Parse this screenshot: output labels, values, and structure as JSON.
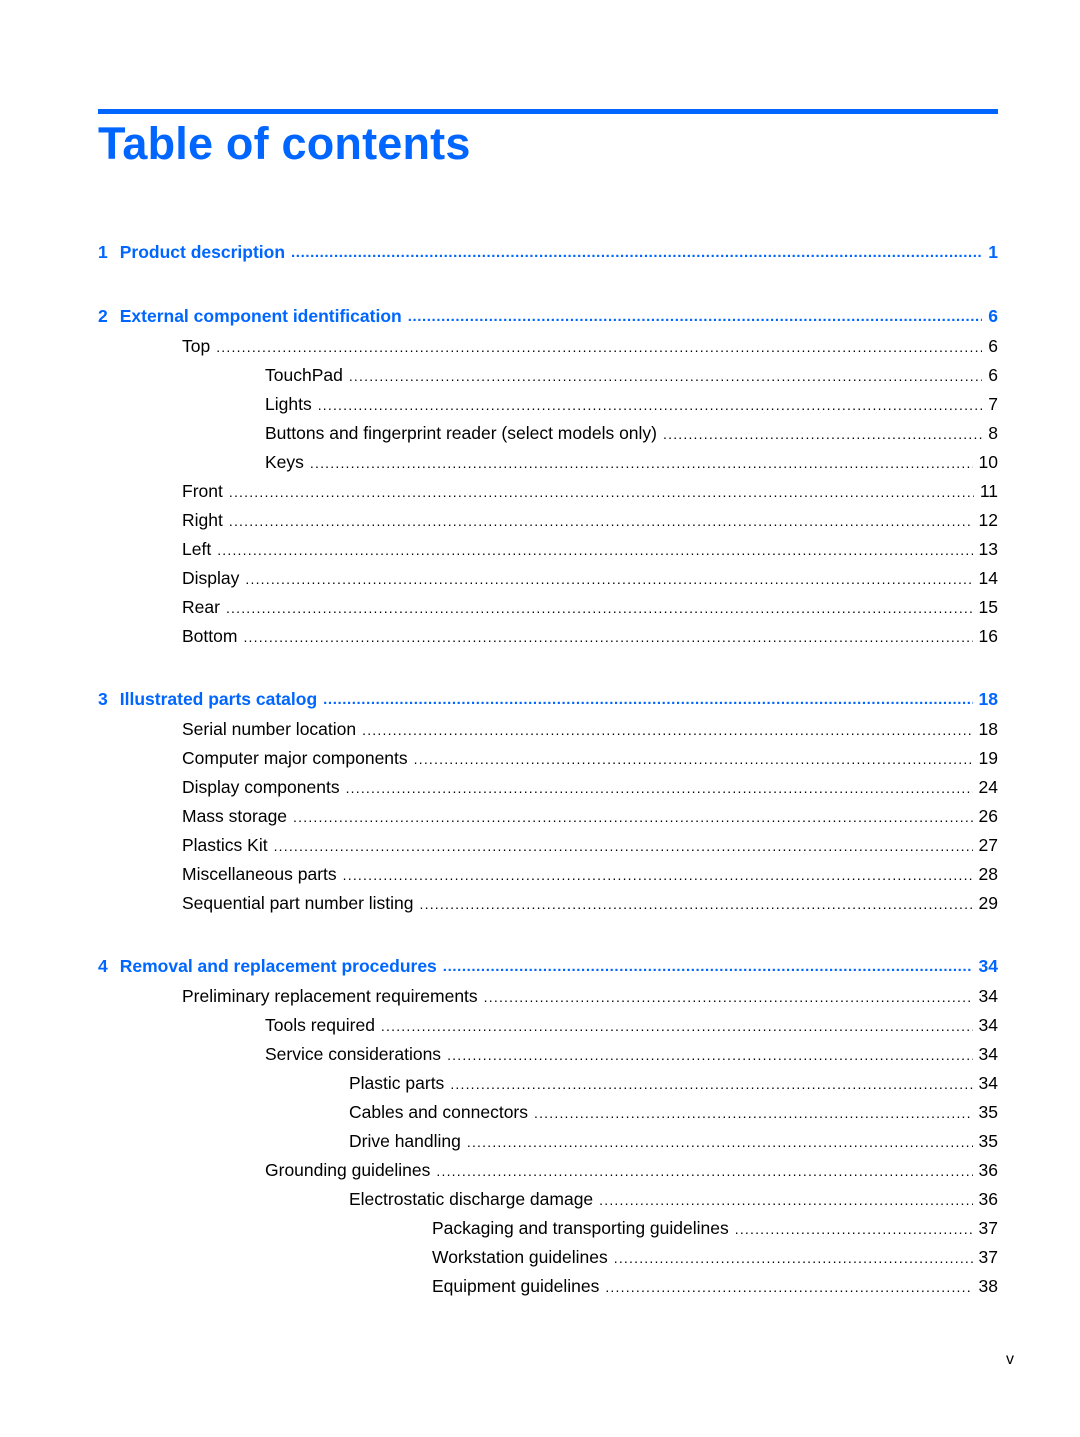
{
  "title": "Table of contents",
  "accent_color": "#0066ff",
  "footer_page": "v",
  "chapters": [
    {
      "number": "1",
      "title": "Product description",
      "page": "1",
      "entries": []
    },
    {
      "number": "2",
      "title": "External component identification",
      "page": "6",
      "entries": [
        {
          "level": 1,
          "title": "Top",
          "page": "6"
        },
        {
          "level": 2,
          "title": "TouchPad",
          "page": "6"
        },
        {
          "level": 2,
          "title": "Lights",
          "page": "7"
        },
        {
          "level": 2,
          "title": "Buttons and fingerprint reader (select models only)",
          "page": "8"
        },
        {
          "level": 2,
          "title": "Keys",
          "page": "10"
        },
        {
          "level": 1,
          "title": "Front",
          "page": "11"
        },
        {
          "level": 1,
          "title": "Right",
          "page": "12"
        },
        {
          "level": 1,
          "title": "Left",
          "page": "13"
        },
        {
          "level": 1,
          "title": "Display",
          "page": "14"
        },
        {
          "level": 1,
          "title": "Rear",
          "page": "15"
        },
        {
          "level": 1,
          "title": "Bottom",
          "page": "16"
        }
      ]
    },
    {
      "number": "3",
      "title": "Illustrated parts catalog",
      "page": "18",
      "entries": [
        {
          "level": 1,
          "title": "Serial number location",
          "page": "18"
        },
        {
          "level": 1,
          "title": "Computer major components",
          "page": "19"
        },
        {
          "level": 1,
          "title": "Display components",
          "page": "24"
        },
        {
          "level": 1,
          "title": "Mass storage",
          "page": "26"
        },
        {
          "level": 1,
          "title": "Plastics Kit",
          "page": "27"
        },
        {
          "level": 1,
          "title": "Miscellaneous parts",
          "page": "28"
        },
        {
          "level": 1,
          "title": "Sequential part number listing",
          "page": "29"
        }
      ]
    },
    {
      "number": "4",
      "title": "Removal and replacement procedures",
      "page": "34",
      "entries": [
        {
          "level": 1,
          "title": "Preliminary replacement requirements",
          "page": "34"
        },
        {
          "level": 2,
          "title": "Tools required",
          "page": "34"
        },
        {
          "level": 2,
          "title": "Service considerations",
          "page": "34"
        },
        {
          "level": 3,
          "title": "Plastic parts",
          "page": "34"
        },
        {
          "level": 3,
          "title": "Cables and connectors",
          "page": "35"
        },
        {
          "level": 3,
          "title": "Drive handling",
          "page": "35"
        },
        {
          "level": 2,
          "title": "Grounding guidelines",
          "page": "36"
        },
        {
          "level": 3,
          "title": "Electrostatic discharge damage",
          "page": "36"
        },
        {
          "level": 4,
          "title": "Packaging and transporting guidelines",
          "page": "37"
        },
        {
          "level": 4,
          "title": "Workstation guidelines",
          "page": "37"
        },
        {
          "level": 4,
          "title": "Equipment guidelines",
          "page": "38"
        }
      ]
    }
  ]
}
